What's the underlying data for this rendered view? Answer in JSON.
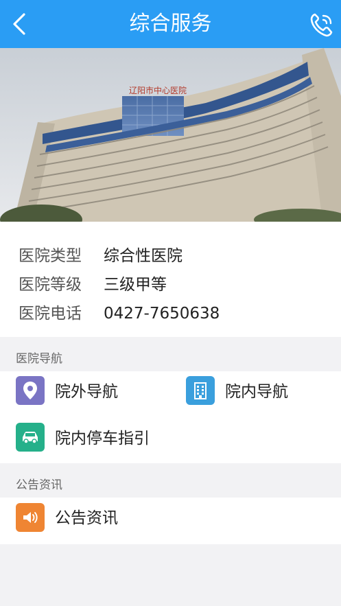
{
  "header": {
    "title": "综合服务",
    "back_icon": "back-chevron-icon",
    "phone_icon": "phone-icon",
    "bg_color": "#2a9df4"
  },
  "hero": {
    "sign_text": "辽阳市中心医院"
  },
  "info": [
    {
      "key": "医院类型",
      "value": "综合性医院"
    },
    {
      "key": "医院等级",
      "value": "三级甲等"
    },
    {
      "key": "医院电话",
      "value": "0427-7650638"
    }
  ],
  "sections": {
    "nav_title": "医院导航",
    "news_title": "公告资讯"
  },
  "nav_items": [
    {
      "label": "院外导航",
      "icon": "location-pin-icon",
      "color": "#7a74c4"
    },
    {
      "label": "院内导航",
      "icon": "building-icon",
      "color": "#3a9fdd"
    },
    {
      "label": "院内停车指引",
      "icon": "car-icon",
      "color": "#25b08a"
    }
  ],
  "news_items": [
    {
      "label": "公告资讯",
      "icon": "speaker-icon",
      "color": "#ef8533"
    }
  ]
}
